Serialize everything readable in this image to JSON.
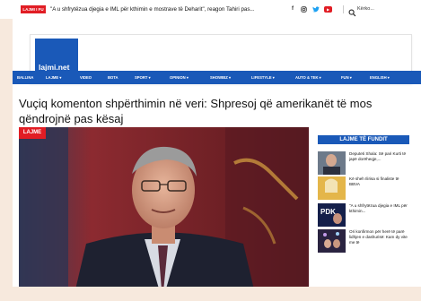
{
  "topbar": {
    "breaking_label": "LAJMI I FU",
    "breaking_text": "\"A u shfrytëzua djegia e IML për kthimin e mostrave të Deharit\", reagon Tahiri pas...",
    "social_icons": [
      "facebook-icon",
      "instagram-icon",
      "twitter-icon",
      "youtube-icon"
    ],
    "search_placeholder": "Kërko..."
  },
  "site": {
    "logo_text": "lajmi.net",
    "brand_color": "#1a59b8",
    "accent_color": "#e11d24"
  },
  "nav": {
    "items": [
      {
        "label": "BALLINA",
        "has_menu": false
      },
      {
        "label": "LAJME",
        "has_menu": true
      },
      {
        "label": "VIDEO",
        "has_menu": false
      },
      {
        "label": "BOTA",
        "has_menu": false
      },
      {
        "label": "SPORT",
        "has_menu": true
      },
      {
        "label": "OPINION",
        "has_menu": true
      },
      {
        "label": "SHOWBIZ",
        "has_menu": true
      },
      {
        "label": "LIFESTYLE",
        "has_menu": true
      },
      {
        "label": "AUTO & TEK",
        "has_menu": true
      },
      {
        "label": "FUN",
        "has_menu": true
      },
      {
        "label": "ENGLISH",
        "has_menu": true
      }
    ]
  },
  "article": {
    "headline": "Vuçiq komenton shpërthimin në veri: Shpresoj që amerikanët të mos qëndrojnë pas kësaj",
    "category_badge": "LAJME"
  },
  "latest": {
    "title": "LAJME TË FUNDIT",
    "items": [
      {
        "text": "Deputeti Shala: Së pari Kurti të japë dorëheqje,..."
      },
      {
        "text": "Kë sheh Ilirisa si finaliste të BBVA"
      },
      {
        "text": "\"A u shfrytëzua djegia e IML për kthimin..."
      },
      {
        "text": "Ori konfirmon për herë të parë lidhjen e dashurisë: Kam dy vite me të"
      }
    ]
  }
}
